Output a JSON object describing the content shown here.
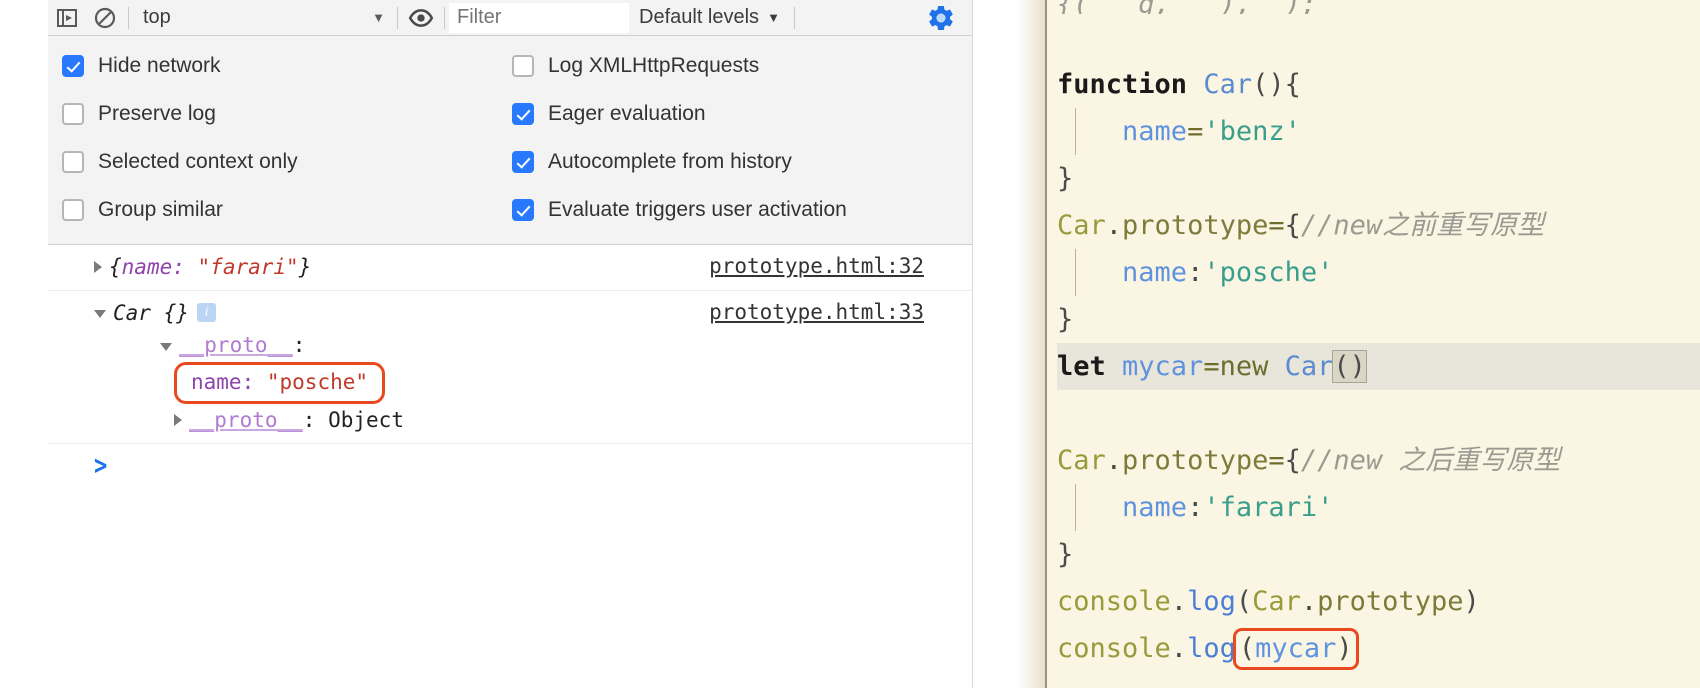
{
  "toolbar": {
    "sidebar_icon": "show-console-sidebar-icon",
    "clear_icon": "clear-console-icon",
    "context_value": "top",
    "context_caret": "▼",
    "eye_icon": "live-expression-eye-icon",
    "filter_placeholder": "Filter",
    "filter_value": "",
    "levels_label": "Default levels",
    "levels_caret": "▼",
    "settings_icon": "settings-gear-icon",
    "accent_blue": "#2979ff",
    "gear_color": "#1f72e8"
  },
  "settings": {
    "left_column": [
      {
        "label": "Hide network",
        "checked": true
      },
      {
        "label": "Preserve log",
        "checked": false
      },
      {
        "label": "Selected context only",
        "checked": false
      },
      {
        "label": "Group similar",
        "checked": false
      }
    ],
    "right_column": [
      {
        "label": "Log XMLHttpRequests",
        "checked": false
      },
      {
        "label": "Eager evaluation",
        "checked": true
      },
      {
        "label": "Autocomplete from history",
        "checked": true
      },
      {
        "label": "Evaluate triggers user activation",
        "checked": true
      }
    ]
  },
  "console": {
    "entry1": {
      "disclosure": "▶",
      "open_brace": "{",
      "key": "name:",
      "value": "\"farari\"",
      "close_brace": "}",
      "source": "prototype.html:32"
    },
    "entry2": {
      "disclosure": "▼",
      "ctor": "Car",
      "braces": "{}",
      "info_badge": "i",
      "source": "prototype.html:33",
      "proto_row": {
        "disclosure": "▼",
        "key": "__proto__",
        "colon": ":"
      },
      "name_row": {
        "key": "name:",
        "value": "\"posche\"",
        "highlighted": true,
        "highlight_color": "#e8491f"
      },
      "nested_proto_row": {
        "disclosure": "▶",
        "key": "__proto__",
        "colon": ":",
        "value": "Object"
      }
    },
    "prompt": ">"
  },
  "editor": {
    "lines": [
      {
        "id": "l0",
        "clipped": true,
        "tokens": [
          {
            "t": "{(   g,   ),  );",
            "c": "k-com"
          }
        ]
      },
      {
        "id": "l1",
        "tokens": []
      },
      {
        "id": "l2",
        "tokens": [
          {
            "t": "function ",
            "c": "k-kw"
          },
          {
            "t": "Car",
            "c": "k-fn"
          },
          {
            "t": "(){",
            "c": "k-punc"
          }
        ]
      },
      {
        "id": "l3",
        "indent_guide": true,
        "tokens": [
          {
            "t": "    ",
            "c": "k-punc"
          },
          {
            "t": "name",
            "c": "k-var"
          },
          {
            "t": "=",
            "c": "k-op"
          },
          {
            "t": "'benz'",
            "c": "k-str"
          }
        ]
      },
      {
        "id": "l4",
        "tokens": [
          {
            "t": "}",
            "c": "k-punc"
          }
        ]
      },
      {
        "id": "l5",
        "tokens": [
          {
            "t": "Car",
            "c": "k-obj"
          },
          {
            "t": ".",
            "c": "k-punc"
          },
          {
            "t": "prototype",
            "c": "k-prop"
          },
          {
            "t": "=",
            "c": "k-op"
          },
          {
            "t": "{",
            "c": "k-punc"
          },
          {
            "t": "//new之前重写原型",
            "c": "k-com"
          }
        ]
      },
      {
        "id": "l6",
        "indent_guide": true,
        "tokens": [
          {
            "t": "    ",
            "c": "k-punc"
          },
          {
            "t": "name",
            "c": "k-var"
          },
          {
            "t": ":",
            "c": "k-punc"
          },
          {
            "t": "'posche'",
            "c": "k-str"
          }
        ]
      },
      {
        "id": "l7",
        "tokens": [
          {
            "t": "}",
            "c": "k-punc"
          }
        ]
      },
      {
        "id": "l8",
        "active": true,
        "tokens": [
          {
            "t": "let ",
            "c": "k-kw"
          },
          {
            "t": "mycar",
            "c": "k-var"
          },
          {
            "t": "=",
            "c": "k-op"
          },
          {
            "t": "new ",
            "c": "k-op"
          },
          {
            "t": "Car",
            "c": "k-fn"
          },
          {
            "t": "()",
            "c": "k-punc bracket-hl"
          }
        ]
      },
      {
        "id": "l9",
        "tokens": []
      },
      {
        "id": "l10",
        "tokens": [
          {
            "t": "Car",
            "c": "k-obj"
          },
          {
            "t": ".",
            "c": "k-punc"
          },
          {
            "t": "prototype",
            "c": "k-prop"
          },
          {
            "t": "=",
            "c": "k-op"
          },
          {
            "t": "{",
            "c": "k-punc"
          },
          {
            "t": "//new 之后重写原型",
            "c": "k-com"
          }
        ]
      },
      {
        "id": "l11",
        "indent_guide": true,
        "tokens": [
          {
            "t": "    ",
            "c": "k-punc"
          },
          {
            "t": "name",
            "c": "k-var"
          },
          {
            "t": ":",
            "c": "k-punc"
          },
          {
            "t": "'farari'",
            "c": "k-str"
          }
        ]
      },
      {
        "id": "l12",
        "tokens": [
          {
            "t": "}",
            "c": "k-punc"
          }
        ]
      },
      {
        "id": "l13",
        "tokens": [
          {
            "t": "console",
            "c": "k-obj"
          },
          {
            "t": ".",
            "c": "k-punc"
          },
          {
            "t": "log",
            "c": "k-meth"
          },
          {
            "t": "(",
            "c": "k-punc"
          },
          {
            "t": "Car",
            "c": "k-obj"
          },
          {
            "t": ".",
            "c": "k-punc"
          },
          {
            "t": "prototype",
            "c": "k-prop"
          },
          {
            "t": ")",
            "c": "k-punc"
          }
        ]
      },
      {
        "id": "l14",
        "tokens": [
          {
            "t": "console",
            "c": "k-obj"
          },
          {
            "t": ".",
            "c": "k-punc"
          },
          {
            "t": "log",
            "c": "k-meth"
          },
          {
            "t": "(",
            "c": "k-punc"
          },
          {
            "t": "mycar",
            "c": "k-var"
          },
          {
            "t": ")",
            "c": "k-punc"
          }
        ],
        "highlight_from": 3,
        "highlight_color": "#e8491f"
      }
    ]
  }
}
